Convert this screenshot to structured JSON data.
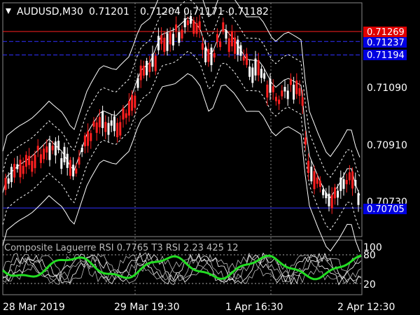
{
  "symbol_header": {
    "symbol": "AUDUSD,M30",
    "ohlc": [
      "0.71201",
      "0.71204",
      "0.71171",
      "0.71182"
    ]
  },
  "price_axis": {
    "ticks": [
      "0.71090",
      "0.70910",
      "0.70730"
    ],
    "tick_values": [
      0.7109,
      0.7091,
      0.7073
    ]
  },
  "price_tags": [
    {
      "text": "0.71269",
      "value": 0.71269,
      "color": "#e00000",
      "line": "solid-red"
    },
    {
      "text": "0.71237",
      "value": 0.71237,
      "color": "#0000e0",
      "line": "dash-blue"
    },
    {
      "text": "0.71194",
      "value": 0.71194,
      "color": "#0000e0",
      "line": "dash-blue"
    },
    {
      "text": "0.70705",
      "value": 0.70705,
      "color": "#0000e0",
      "line": "solid-blue"
    }
  ],
  "indicator": {
    "title": "Composite Laguerre RSI 0.7765 T3 RSI 2.23 425 12",
    "levels": [
      "100",
      "80",
      "20"
    ],
    "line_color": "#22dd22"
  },
  "time_axis": [
    "28 Mar 2019",
    "29 Mar 19:30",
    "1 Apr 16:30",
    "2 Apr 12:30"
  ],
  "colors": {
    "bull": "#ffffff",
    "bear": "#ff2020",
    "band": "#ffffff",
    "bg": "#000000"
  }
}
